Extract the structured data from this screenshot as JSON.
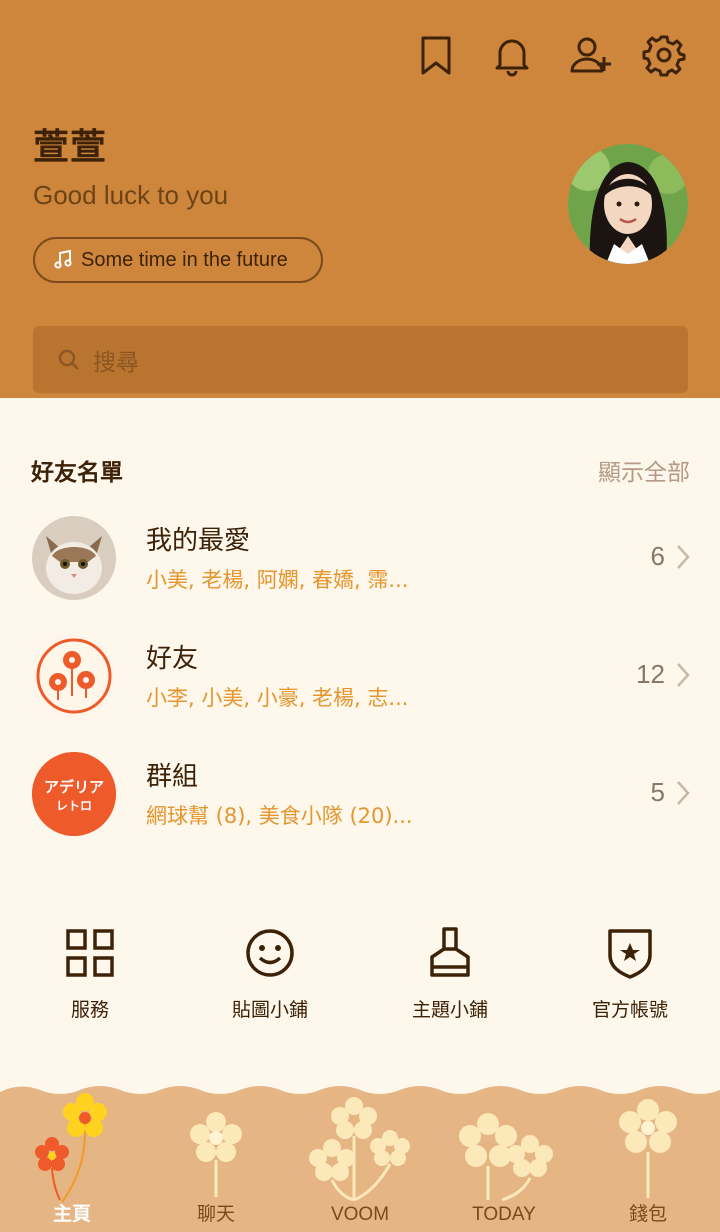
{
  "header": {
    "user_name": "萱萱",
    "status_message": "Good luck to you",
    "music_label": "Some time in the future",
    "icons": [
      "bookmark-icon",
      "bell-icon",
      "add-friend-icon",
      "gear-icon"
    ]
  },
  "search": {
    "placeholder": "搜尋"
  },
  "friends": {
    "section_title": "好友名單",
    "show_all": "顯示全部",
    "rows": [
      {
        "title": "我的最愛",
        "members": "小美, 老楊, 阿嫻, 春嬌, 霈...",
        "count": "6"
      },
      {
        "title": "好友",
        "members": "小李, 小美, 小豪, 老楊, 志...",
        "count": "12"
      },
      {
        "title": "群組",
        "members": "網球幫 (8), 美食小隊 (20)...",
        "count": "5"
      }
    ]
  },
  "group_avatar_text": {
    "line1": "アデリア",
    "line2": "レトロ"
  },
  "quick_actions": [
    {
      "label": "服務",
      "icon": "grid-icon"
    },
    {
      "label": "貼圖小鋪",
      "icon": "smiley-icon"
    },
    {
      "label": "主題小鋪",
      "icon": "brush-icon"
    },
    {
      "label": "官方帳號",
      "icon": "shield-star-icon"
    }
  ],
  "bottom_nav": [
    {
      "label": "主頁",
      "active": true
    },
    {
      "label": "聊天",
      "active": false
    },
    {
      "label": "VOOM",
      "active": false
    },
    {
      "label": "TODAY",
      "active": false
    },
    {
      "label": "錢包",
      "active": false
    }
  ],
  "colors": {
    "header_bg": "#cd863c",
    "accent_orange": "#e5962e",
    "page_bg": "#fdf7ec",
    "text_dark": "#3d2208"
  }
}
